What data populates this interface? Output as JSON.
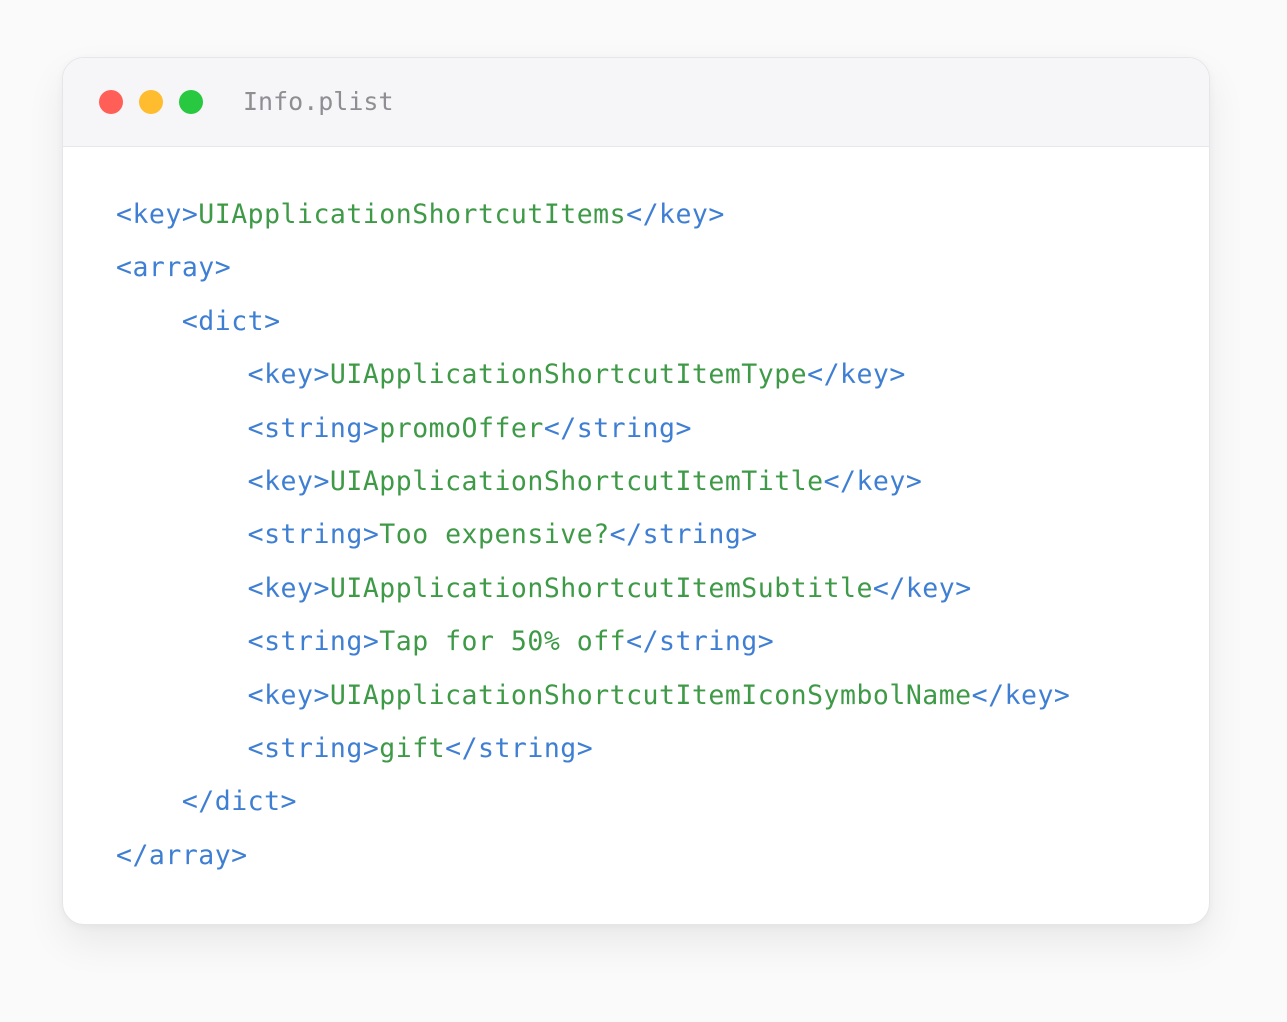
{
  "colors": {
    "close": "#ff5f57",
    "minimize": "#febc2e",
    "maximize": "#28c840",
    "tag": "#3f7fd3",
    "text": "#3e9a47"
  },
  "window": {
    "title": "Info.plist"
  },
  "code_lines": [
    {
      "indent": "",
      "open": "<key>",
      "content": "UIApplicationShortcutItems",
      "close": "</key>"
    },
    {
      "indent": "",
      "open": "<array>",
      "content": "",
      "close": ""
    },
    {
      "indent": "    ",
      "open": "<dict>",
      "content": "",
      "close": ""
    },
    {
      "indent": "        ",
      "open": "<key>",
      "content": "UIApplicationShortcutItemType",
      "close": "</key>"
    },
    {
      "indent": "        ",
      "open": "<string>",
      "content": "promoOffer",
      "close": "</string>"
    },
    {
      "indent": "        ",
      "open": "<key>",
      "content": "UIApplicationShortcutItemTitle",
      "close": "</key>"
    },
    {
      "indent": "        ",
      "open": "<string>",
      "content": "Too expensive?",
      "close": "</string>"
    },
    {
      "indent": "        ",
      "open": "<key>",
      "content": "UIApplicationShortcutItemSubtitle",
      "close": "</key>"
    },
    {
      "indent": "        ",
      "open": "<string>",
      "content": "Tap for 50% off",
      "close": "</string>"
    },
    {
      "indent": "        ",
      "open": "<key>",
      "content": "UIApplicationShortcutItemIconSymbolName",
      "close": "</key>"
    },
    {
      "indent": "        ",
      "open": "<string>",
      "content": "gift",
      "close": "</string>"
    },
    {
      "indent": "    ",
      "open": "</dict>",
      "content": "",
      "close": ""
    },
    {
      "indent": "",
      "open": "</array>",
      "content": "",
      "close": ""
    }
  ]
}
